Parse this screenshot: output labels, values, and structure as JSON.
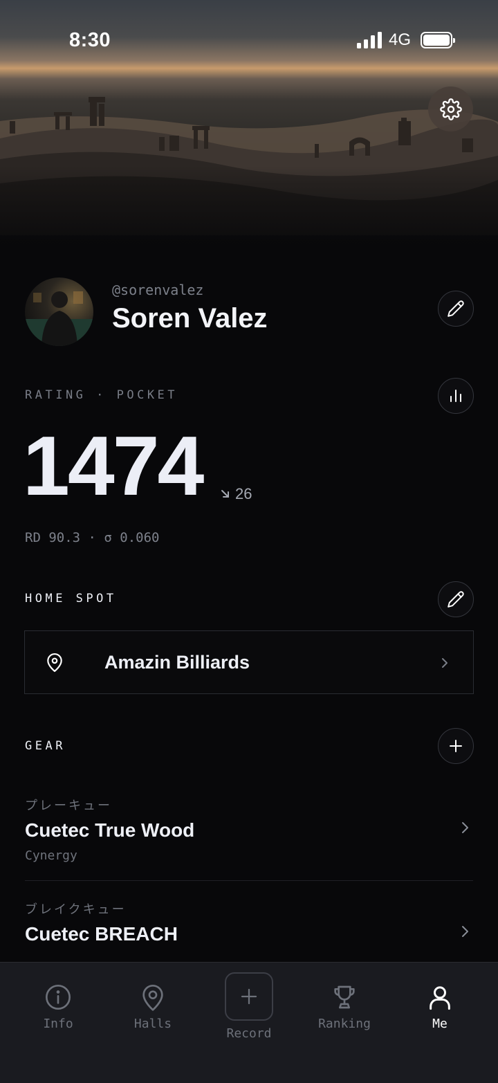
{
  "status_bar": {
    "time": "8:30",
    "network": "4G"
  },
  "profile": {
    "handle": "@sorenvalez",
    "name": "Soren Valez"
  },
  "rating": {
    "label": "RATING · POCKET",
    "value": "1474",
    "delta": "26",
    "delta_direction": "down",
    "stats": "RD 90.3 · σ 0.060"
  },
  "home_spot": {
    "label": "HOME SPOT",
    "venue": "Amazin Billiards"
  },
  "gear": {
    "label": "GEAR",
    "items": [
      {
        "type": "プレーキュー",
        "name": "Cuetec True Wood",
        "brand": "Cynergy"
      },
      {
        "type": "ブレイクキュー",
        "name": "Cuetec BREACH",
        "brand": ""
      }
    ]
  },
  "tabs": [
    {
      "label": "Info",
      "icon": "info-icon",
      "active": false
    },
    {
      "label": "Halls",
      "icon": "location-pin-icon",
      "active": false
    },
    {
      "label": "Record",
      "icon": "plus-icon",
      "active": false
    },
    {
      "label": "Ranking",
      "icon": "trophy-icon",
      "active": false
    },
    {
      "label": "Me",
      "icon": "person-icon",
      "active": true
    }
  ],
  "colors": {
    "background": "#08080a",
    "text": "#eef0f6",
    "muted": "#6f737c",
    "tabbar": "#1a1b20",
    "active_tab": "#ffffff"
  }
}
